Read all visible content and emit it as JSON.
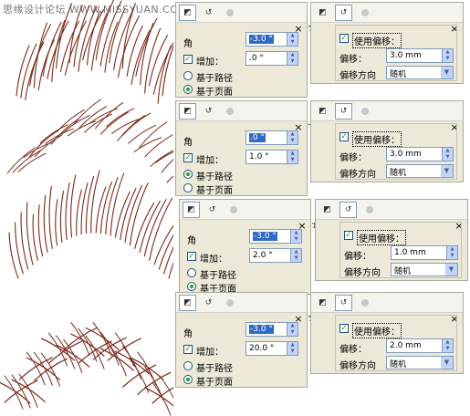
{
  "watermark": "思缘设计论坛 WWW.MISSYUAN.COM",
  "brush_color": "#7a2a1a",
  "accent_color": "#316ac5",
  "rows": [
    {
      "left": {
        "angle_label": "角",
        "angle_value": "-3.0 °",
        "angle_selected": true,
        "increment_label": "增加：",
        "increment_value": ".0 °",
        "increment_checked": true,
        "radio_path": "基于路径",
        "radio_page": "基于页面",
        "selected": "page"
      },
      "right": {
        "ruler_text": "12",
        "use_offset_label": "使用偏移：",
        "use_offset_checked": true,
        "offset_label": "偏移：",
        "offset_value": "3.0 mm",
        "direction_label": "偏移方向",
        "direction_value": "随机"
      }
    },
    {
      "left": {
        "angle_label": "角",
        "angle_value": ".0 °",
        "angle_selected": true,
        "increment_label": "增加：",
        "increment_value": "1.0 °",
        "increment_checked": true,
        "radio_path": "基于路径",
        "radio_page": "基于页面",
        "selected": "path"
      },
      "right": {
        "ruler_text": "",
        "use_offset_label": "使用偏移：",
        "use_offset_checked": true,
        "offset_label": "偏移：",
        "offset_value": "3.0 mm",
        "direction_label": "偏移方向",
        "direction_value": "随机"
      }
    },
    {
      "left": {
        "angle_label": "角",
        "angle_value": "-3.0 °",
        "angle_selected": true,
        "increment_label": "增加：",
        "increment_value": "2.0 °",
        "increment_checked": true,
        "radio_path": "基于路径",
        "radio_page": "基于页面",
        "selected": "page"
      },
      "right": {
        "ruler_text": "1",
        "use_offset_label": "使用偏移：",
        "use_offset_checked": true,
        "offset_label": "偏移：",
        "offset_value": "1.0 mm",
        "direction_label": "偏移方向",
        "direction_value": "随机"
      }
    },
    {
      "left": {
        "angle_label": "角",
        "angle_value": "-3.0 °",
        "angle_selected": true,
        "increment_label": "增加：",
        "increment_value": "20.0 °",
        "increment_checked": true,
        "radio_path": "基于路径",
        "radio_page": "基于页面",
        "selected": "page"
      },
      "right": {
        "ruler_text": "1",
        "use_offset_label": "使用偏移：",
        "use_offset_checked": true,
        "offset_label": "偏移：",
        "offset_value": "2.0 mm",
        "direction_label": "偏移方向",
        "direction_value": "随机"
      }
    }
  ]
}
